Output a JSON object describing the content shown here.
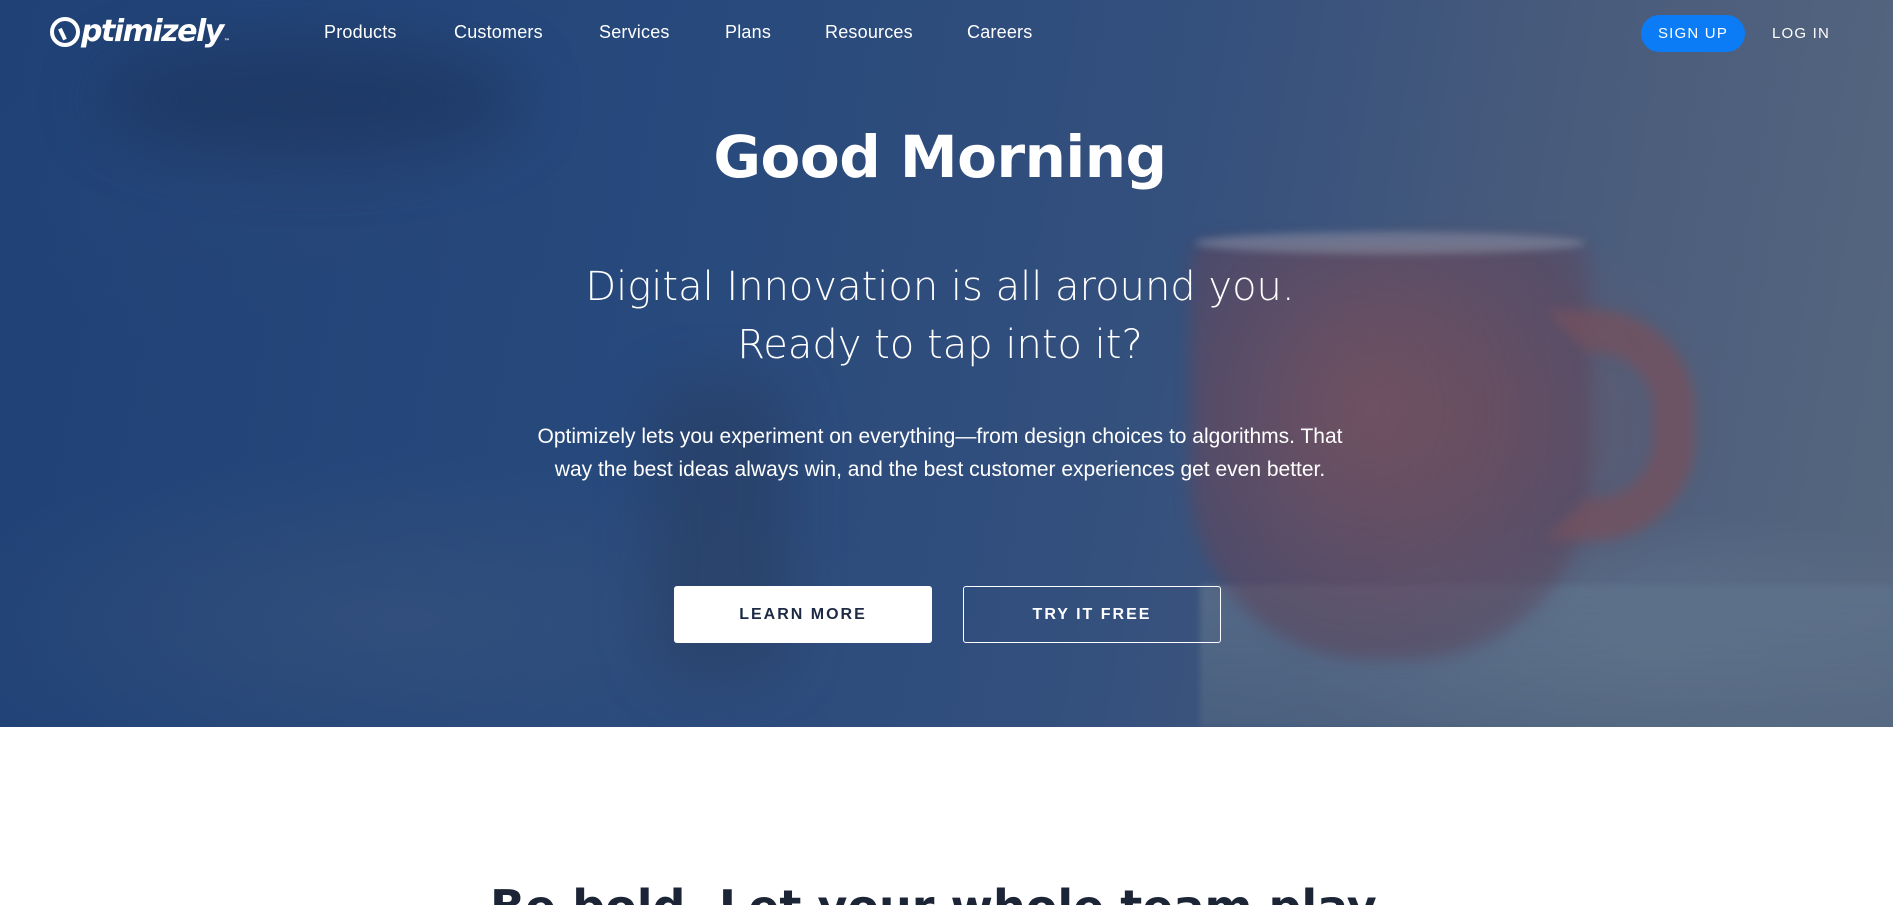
{
  "brand": {
    "name": "ptimizely",
    "tm": "™",
    "accent_color": "#0b7cf5"
  },
  "nav": {
    "items": [
      {
        "label": "Products"
      },
      {
        "label": "Customers"
      },
      {
        "label": "Services"
      },
      {
        "label": "Plans"
      },
      {
        "label": "Resources"
      },
      {
        "label": "Careers"
      }
    ],
    "signup_label": "SIGN UP",
    "login_label": "LOG IN"
  },
  "hero": {
    "title": "Good Morning",
    "subtitle_line1": "Digital Innovation is all around you.",
    "subtitle_line2": "Ready to tap into it?",
    "description_line1": "Optimizely lets you experiment on everything—from design choices to algorithms. That",
    "description_line2": "way the best ideas always win, and the best customer experiences get even better.",
    "learn_more_label": "LEARN MORE",
    "try_free_label": "TRY IT FREE"
  },
  "section": {
    "heading": "Be bold. Let your whole team play."
  }
}
